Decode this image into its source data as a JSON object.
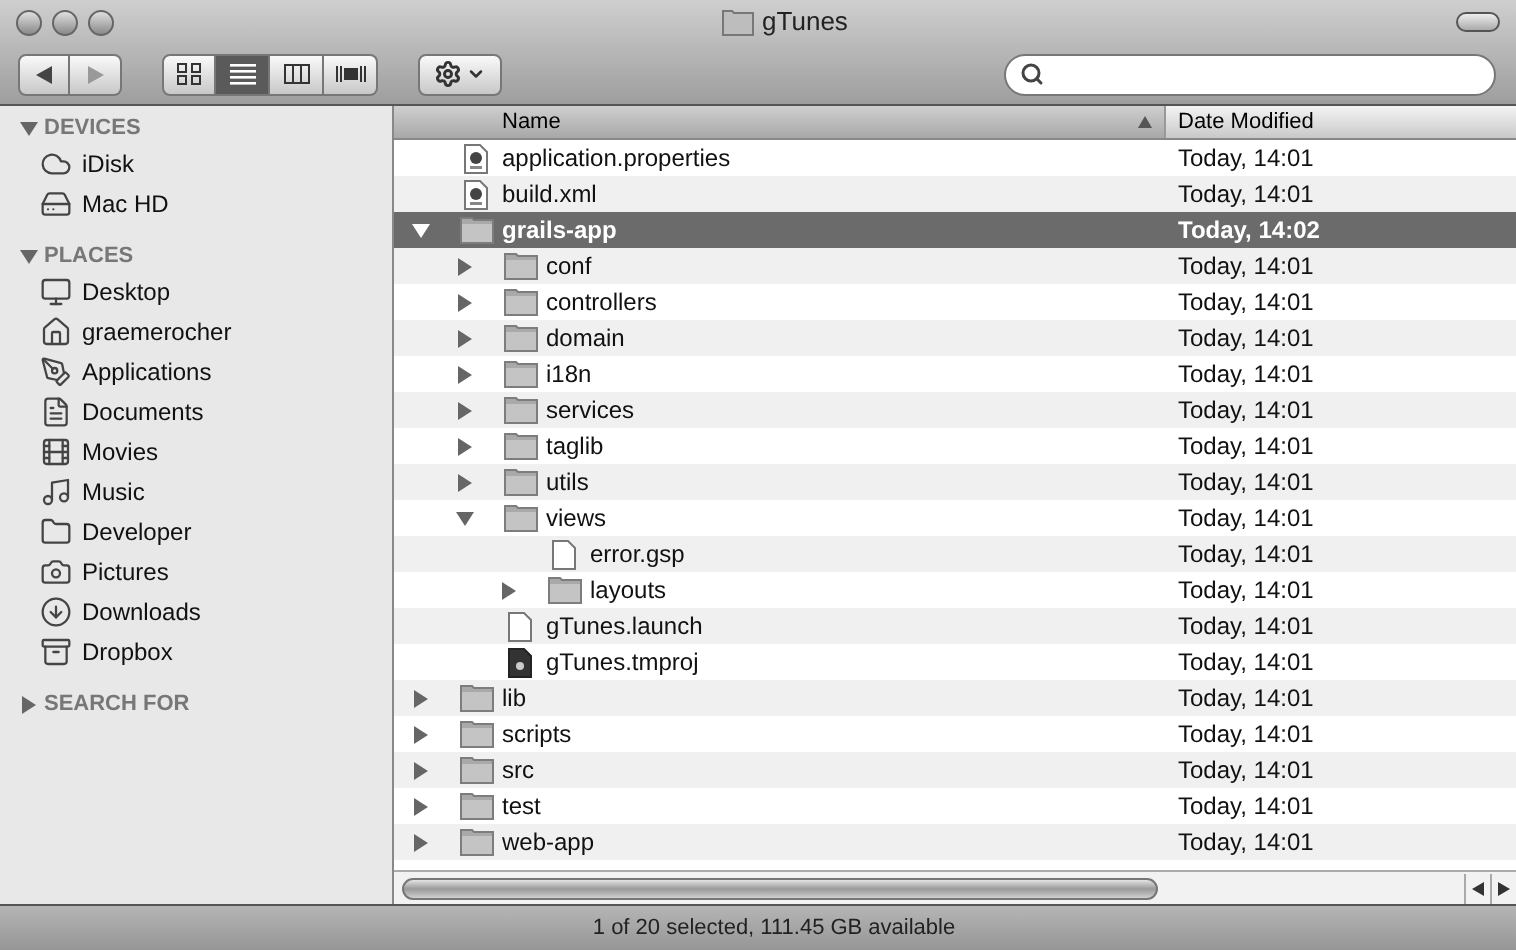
{
  "window": {
    "title": "gTunes"
  },
  "toolbar": {
    "view_buttons": [
      {
        "selected": false
      },
      {
        "selected": true
      },
      {
        "selected": false
      },
      {
        "selected": false
      }
    ]
  },
  "sidebar": {
    "sections": [
      {
        "title": "DEVICES",
        "expanded": true,
        "items": [
          {
            "label": "iDisk"
          },
          {
            "label": "Mac HD"
          }
        ]
      },
      {
        "title": "PLACES",
        "expanded": true,
        "items": [
          {
            "label": "Desktop"
          },
          {
            "label": "graemerocher"
          },
          {
            "label": "Applications"
          },
          {
            "label": "Documents"
          },
          {
            "label": "Movies"
          },
          {
            "label": "Music"
          },
          {
            "label": "Developer"
          },
          {
            "label": "Pictures"
          },
          {
            "label": "Downloads"
          },
          {
            "label": "Dropbox"
          }
        ]
      },
      {
        "title": "SEARCH FOR",
        "expanded": false
      }
    ]
  },
  "table": {
    "columns": [
      "Name",
      "Date Modified"
    ],
    "rows": [
      {
        "name": "application.properties",
        "kind": "config",
        "date": "Today, 14:01",
        "selected": false
      },
      {
        "name": "build.xml",
        "kind": "config",
        "date": "Today, 14:01",
        "selected": false
      },
      {
        "name": "grails-app",
        "kind": "folder",
        "date": "Today, 14:02",
        "selected": true,
        "expanded": true,
        "children": [
          {
            "name": "conf",
            "kind": "folder",
            "date": "Today, 14:01",
            "selected": false,
            "expanded": false
          },
          {
            "name": "controllers",
            "kind": "folder",
            "date": "Today, 14:01",
            "selected": false,
            "expanded": false
          },
          {
            "name": "domain",
            "kind": "folder",
            "date": "Today, 14:01",
            "selected": false,
            "expanded": false
          },
          {
            "name": "i18n",
            "kind": "folder",
            "date": "Today, 14:01",
            "selected": false,
            "expanded": false
          },
          {
            "name": "services",
            "kind": "folder",
            "date": "Today, 14:01",
            "selected": false,
            "expanded": false
          },
          {
            "name": "taglib",
            "kind": "folder",
            "date": "Today, 14:01",
            "selected": false,
            "expanded": false
          },
          {
            "name": "utils",
            "kind": "folder",
            "date": "Today, 14:01",
            "selected": false,
            "expanded": false
          },
          {
            "name": "views",
            "kind": "folder",
            "date": "Today, 14:01",
            "selected": false,
            "expanded": true,
            "children": [
              {
                "name": "error.gsp",
                "kind": "file",
                "date": "Today, 14:01",
                "selected": false
              },
              {
                "name": "layouts",
                "kind": "folder",
                "date": "Today, 14:01",
                "selected": false,
                "expanded": false
              }
            ]
          },
          {
            "name": "gTunes.launch",
            "kind": "file",
            "date": "Today, 14:01",
            "selected": false
          },
          {
            "name": "gTunes.tmproj",
            "kind": "project",
            "date": "Today, 14:01",
            "selected": false
          }
        ]
      },
      {
        "name": "lib",
        "kind": "folder",
        "date": "Today, 14:01",
        "selected": false,
        "expanded": false
      },
      {
        "name": "scripts",
        "kind": "folder",
        "date": "Today, 14:01",
        "selected": false,
        "expanded": false
      },
      {
        "name": "src",
        "kind": "folder",
        "date": "Today, 14:01",
        "selected": false,
        "expanded": false
      },
      {
        "name": "test",
        "kind": "folder",
        "date": "Today, 14:01",
        "selected": false,
        "expanded": false
      },
      {
        "name": "web-app",
        "kind": "folder",
        "date": "Today, 14:01",
        "selected": false,
        "expanded": false
      }
    ]
  },
  "status_bar": "1 of 20 selected, 111.45 GB available"
}
